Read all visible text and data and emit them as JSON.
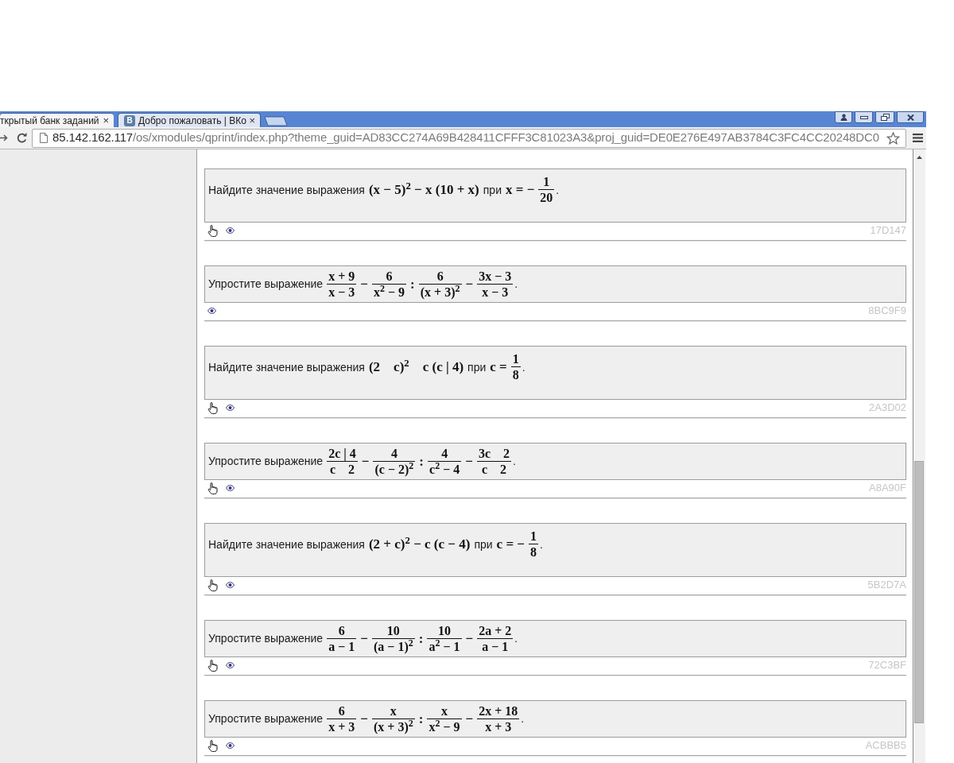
{
  "browser": {
    "tabs": [
      {
        "title": "ткрытый банк заданий",
        "close": "×",
        "selected": true
      },
      {
        "badge": "В",
        "title": "Добро пожаловать | ВКо",
        "close": "×",
        "selected": false
      }
    ],
    "address": {
      "host": "85.142.162.117",
      "path": "/os/xmodules/qprint/index.php?theme_guid=AD83CC274A69B428411CFFF3C81023A3&proj_guid=DE0E276E497AB3784C3FC4CC20248DC0"
    }
  },
  "tasks": [
    {
      "kind": "find",
      "prompt": "Найдите значение выражения",
      "expression": "(x − 5)$^{2}$ − x (10 + x)",
      "given": "при",
      "equation": "x = −",
      "value": {
        "num": "1",
        "den": "20"
      },
      "end": ".",
      "pointer": true,
      "code": "17D147"
    },
    {
      "kind": "simplify",
      "prompt": "Упростите выражение",
      "terms": [
        {
          "num": "x + 9",
          "den": "x − 3"
        },
        {
          "op": "−",
          "num": "6",
          "den": "x$^{2}$ − 9"
        },
        {
          "op": ":",
          "num": "6",
          "den": "(x + 3)$^{2}$"
        },
        {
          "op": "−",
          "num": "3x − 3",
          "den": "x − 3"
        }
      ],
      "end": ".",
      "pointer": false,
      "code": "8BC9F9"
    },
    {
      "kind": "find",
      "prompt": "Найдите значение выражения",
      "expression": "(2    c)$^{2}$    c (c | 4)",
      "given": "при",
      "equation": "c =",
      "value": {
        "num": "1",
        "den": "8"
      },
      "end": ".",
      "pointer": true,
      "code": "2A3D02"
    },
    {
      "kind": "simplify",
      "prompt": "Упростите выражение",
      "terms": [
        {
          "num": "2c | 4",
          "den": "c    2"
        },
        {
          "op": "−",
          "num": "4",
          "den": "(c − 2)$^{2}$"
        },
        {
          "op": ":",
          "num": "4",
          "den": "c$^{2}$ − 4"
        },
        {
          "op": "−",
          "num": "3c    2",
          "den": "c    2"
        }
      ],
      "end": ".",
      "pointer": true,
      "code": "A8A90F"
    },
    {
      "kind": "find",
      "prompt": "Найдите значение выражения",
      "expression": "(2 + c)$^{2}$ − c (c − 4)",
      "given": "при",
      "equation": "c = −",
      "value": {
        "num": "1",
        "den": "8"
      },
      "end": ".",
      "pointer": true,
      "code": "5B2D7A"
    },
    {
      "kind": "simplify",
      "prompt": "Упростите выражение",
      "terms": [
        {
          "num": "6",
          "den": "a − 1"
        },
        {
          "op": "−",
          "num": "10",
          "den": "(a − 1)$^{2}$"
        },
        {
          "op": ":",
          "num": "10",
          "den": "a$^{2}$ − 1"
        },
        {
          "op": "−",
          "num": "2a + 2",
          "den": "a − 1"
        }
      ],
      "end": ".",
      "pointer": true,
      "code": "72C3BF"
    },
    {
      "kind": "simplify",
      "prompt": "Упростите выражение",
      "terms": [
        {
          "num": "6",
          "den": "x + 3"
        },
        {
          "op": "−",
          "num": "x",
          "den": "(x + 3)$^{2}$"
        },
        {
          "op": ":",
          "num": "x",
          "den": "x$^{2}$ − 9"
        },
        {
          "op": "−",
          "num": "2x + 18",
          "den": "x + 3"
        }
      ],
      "end": ".",
      "pointer": true,
      "code": "ACBBB5"
    }
  ]
}
